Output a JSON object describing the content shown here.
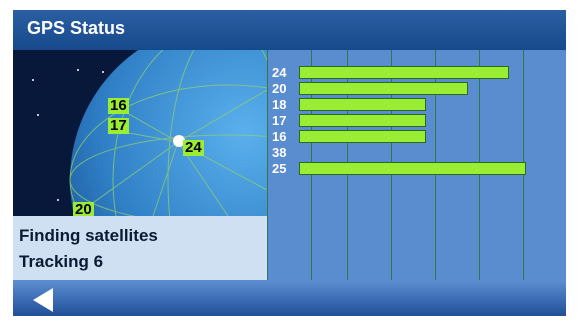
{
  "header": {
    "title": "GPS Status"
  },
  "status": {
    "line1": "Finding satellites",
    "line2": "Tracking  6"
  },
  "sky_labels": [
    {
      "id": "16"
    },
    {
      "id": "17"
    },
    {
      "id": "24"
    },
    {
      "id": "20"
    }
  ],
  "signal_bars": [
    {
      "id": "24",
      "strength": 0.85
    },
    {
      "id": "20",
      "strength": 0.68
    },
    {
      "id": "18",
      "strength": 0.51
    },
    {
      "id": "17",
      "strength": 0.51
    },
    {
      "id": "16",
      "strength": 0.51
    },
    {
      "id": "38",
      "strength": 0.0
    },
    {
      "id": "25",
      "strength": 0.92
    }
  ],
  "colors": {
    "header": "#164a8c",
    "satellite": "#99ee33",
    "panel": "#5a8cd0",
    "status_bg": "#cfe0f2"
  },
  "icons": {
    "back": "triangle-left-icon"
  }
}
